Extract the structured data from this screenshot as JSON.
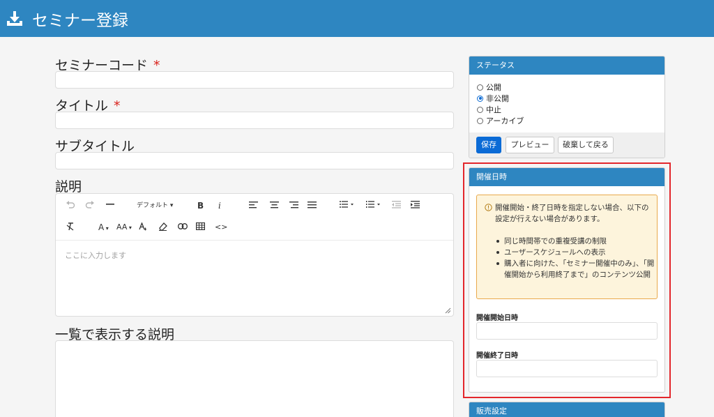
{
  "header": {
    "title": "セミナー登録",
    "icon": "download-icon"
  },
  "form": {
    "seminar_code_label": "セミナーコード",
    "title_label": "タイトル",
    "subtitle_label": "サブタイトル",
    "description_label": "説明",
    "list_description_label": "一覧で表示する説明",
    "required_mark": "*"
  },
  "editor": {
    "font_dropdown": "デフォルト",
    "bold": "B",
    "italic": "i",
    "font_color": "A",
    "font_size": "AA",
    "code": "<>",
    "placeholder": "ここに入力します"
  },
  "status_panel": {
    "title": "ステータス",
    "options": [
      "公開",
      "非公開",
      "中止",
      "アーカイブ"
    ],
    "selected": "非公開",
    "save_label": "保存",
    "preview_label": "プレビュー",
    "discard_label": "破棄して戻る"
  },
  "schedule_panel": {
    "title": "開催日時",
    "warning": "開催開始・終了日時を指定しない場合、以下の設定が行えない場合があります。",
    "bullets": [
      "同じ時間帯での重複受講の制限",
      "ユーザースケジュールへの表示",
      "購入者に向けた、「セミナー開催中のみ」、「開催開始から利用終了まで」のコンテンツ公開"
    ],
    "start_label": "開催開始日時",
    "end_label": "開催終了日時"
  },
  "sales_panel": {
    "title": "販売設定"
  },
  "colors": {
    "header": "#2e86c1",
    "primary_button": "#0b6bd6",
    "required": "#d9221c",
    "highlight": "#e3262b",
    "warning_bg": "#fdf4dc"
  }
}
